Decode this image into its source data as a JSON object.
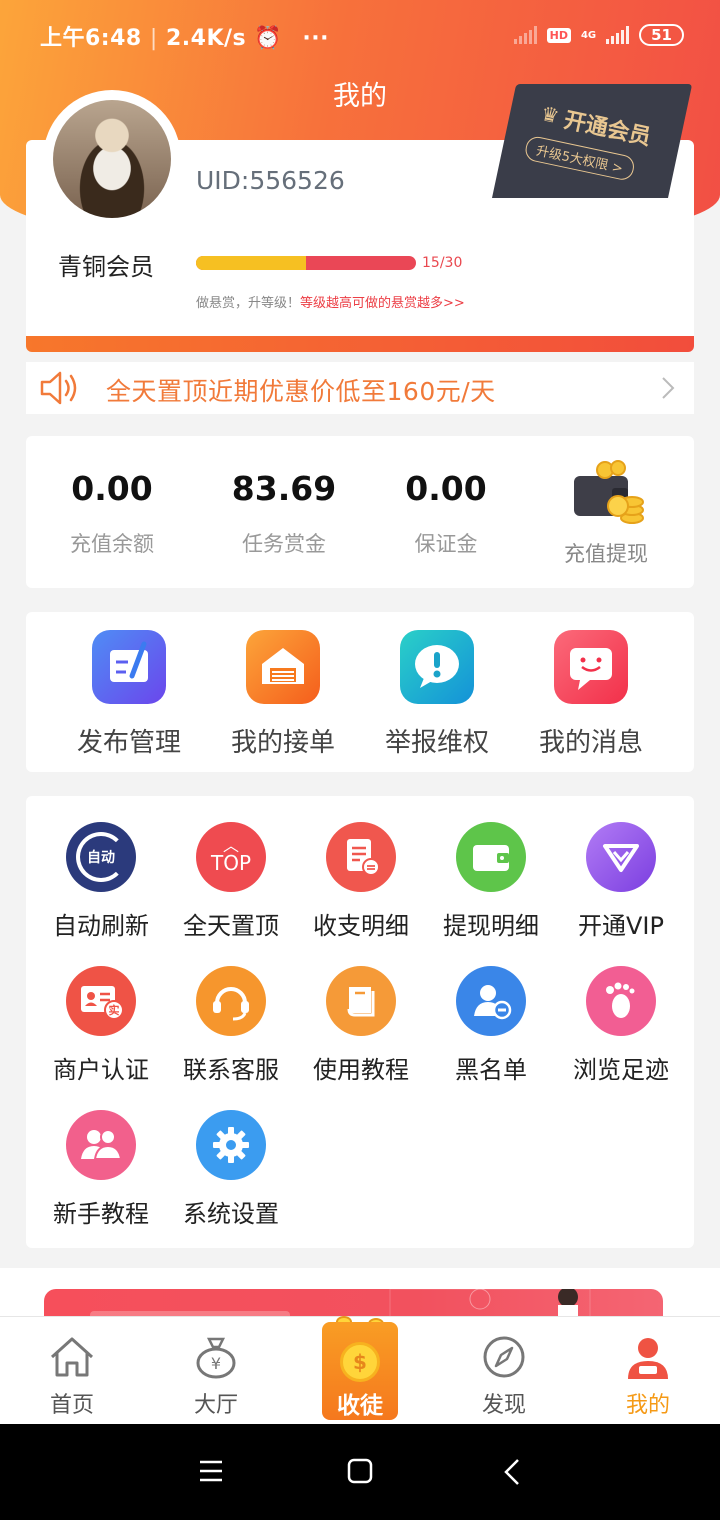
{
  "status_bar": {
    "time": "上午6:48",
    "speed": "2.4K/s",
    "dots": "···",
    "hd": "HD",
    "network": "4G",
    "battery": "51"
  },
  "header": {
    "title": "我的"
  },
  "member": {
    "uid": "UID:556526",
    "level_name": "青铜会员",
    "progress_text": "15/30",
    "progress_fraction": 0.5,
    "tip_prefix": "做悬赏，升等级！",
    "tip_highlight": "等级越高可做的悬赏越多>>",
    "vip_title": "开通会员",
    "vip_sub": "升级5大权限 >"
  },
  "notice": {
    "text": "全天置顶近期优惠价低至160元/天"
  },
  "wallet": {
    "items": [
      {
        "value": "0.00",
        "label": "充值余额"
      },
      {
        "value": "83.69",
        "label": "任务赏金"
      },
      {
        "value": "0.00",
        "label": "保证金"
      }
    ],
    "action_label": "充值提现"
  },
  "quick": {
    "items": [
      {
        "label": "发布管理",
        "icon": "edit-icon",
        "color": "#5b5ff0"
      },
      {
        "label": "我的接单",
        "icon": "store-icon",
        "color": "#f87a1c"
      },
      {
        "label": "举报维权",
        "icon": "exclamation-icon",
        "color": "#14aebf"
      },
      {
        "label": "我的消息",
        "icon": "message-icon",
        "color": "#f5455b"
      }
    ]
  },
  "grid": {
    "items": [
      {
        "label": "自动刷新",
        "icon": "auto-refresh-icon",
        "glyph": "自动",
        "color": "#2b3a7c"
      },
      {
        "label": "全天置顶",
        "icon": "top-icon",
        "glyph": "TOP",
        "color": "#ef4b50"
      },
      {
        "label": "收支明细",
        "icon": "bill-icon",
        "glyph": "≡",
        "color": "#f0574e"
      },
      {
        "label": "提现明细",
        "icon": "wallet-icon",
        "glyph": "▭",
        "color": "#5ec54a"
      },
      {
        "label": "开通VIP",
        "icon": "diamond-icon",
        "glyph": "◇",
        "color": "#8d52ea"
      },
      {
        "label": "商户认证",
        "icon": "merchant-icon",
        "glyph": "实",
        "color": "#ef5346"
      },
      {
        "label": "联系客服",
        "icon": "headset-icon",
        "glyph": "☎",
        "color": "#f6962d"
      },
      {
        "label": "使用教程",
        "icon": "book-icon",
        "glyph": "▤",
        "color": "#f59a38"
      },
      {
        "label": "黑名单",
        "icon": "block-user-icon",
        "glyph": "⊖",
        "color": "#3a86e8"
      },
      {
        "label": "浏览足迹",
        "icon": "footprint-icon",
        "glyph": "✿",
        "color": "#f25e93"
      },
      {
        "label": "新手教程",
        "icon": "users-icon",
        "glyph": "⚇",
        "color": "#f2608c"
      },
      {
        "label": "系统设置",
        "icon": "gear-icon",
        "glyph": "⚙",
        "color": "#3b9cf0"
      }
    ]
  },
  "tabbar": {
    "items": [
      {
        "label": "首页",
        "icon": "home-icon"
      },
      {
        "label": "大厅",
        "icon": "money-bag-icon"
      },
      {
        "label": "收徒",
        "icon": "coin-icon"
      },
      {
        "label": "发现",
        "icon": "compass-icon"
      },
      {
        "label": "我的",
        "icon": "user-icon"
      }
    ],
    "active_color": "#f59a16"
  }
}
